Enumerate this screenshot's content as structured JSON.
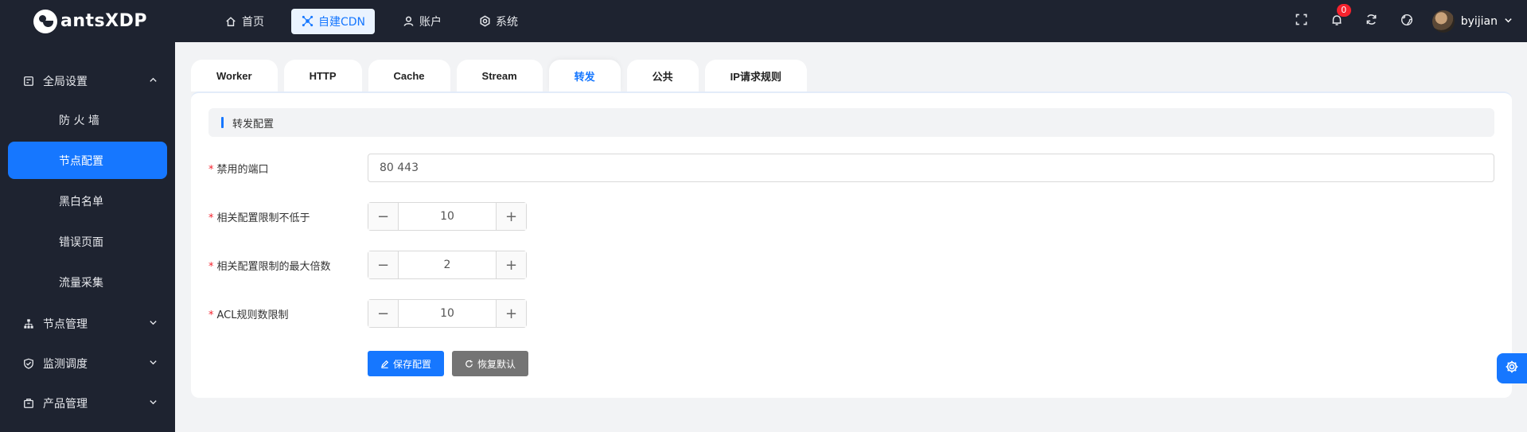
{
  "brand": {
    "name": "antsXDP"
  },
  "topnav": [
    {
      "label": "首页",
      "icon": "home-icon"
    },
    {
      "label": "自建CDN",
      "icon": "cdn-icon",
      "active": true
    },
    {
      "label": "账户",
      "icon": "user-icon"
    },
    {
      "label": "系统",
      "icon": "settings-icon"
    }
  ],
  "header": {
    "notification_count": "0",
    "username": "byijian"
  },
  "sidebar": {
    "group_global": "全局设置",
    "items": [
      {
        "label": "防 火 墙"
      },
      {
        "label": "节点配置",
        "active": true
      },
      {
        "label": "黑白名单"
      },
      {
        "label": "错误页面"
      },
      {
        "label": "流量采集"
      }
    ],
    "group_nodes": "节点管理",
    "group_monitor": "监测调度",
    "group_product": "产品管理"
  },
  "tabs": [
    {
      "label": "Worker"
    },
    {
      "label": "HTTP"
    },
    {
      "label": "Cache"
    },
    {
      "label": "Stream"
    },
    {
      "label": "转发",
      "active": true
    },
    {
      "label": "公共"
    },
    {
      "label": "IP请求规则"
    }
  ],
  "section": {
    "title": "转发配置"
  },
  "form": {
    "required_mark": "*",
    "banned_ports": {
      "label": "禁用的端口",
      "value": "80 443"
    },
    "min_limit": {
      "label": "相关配置限制不低于",
      "value": "10"
    },
    "max_multiple": {
      "label": "相关配置限制的最大倍数",
      "value": "2"
    },
    "acl_limit": {
      "label": "ACL规则数限制",
      "value": "10"
    }
  },
  "actions": {
    "save": "保存配置",
    "reset": "恢复默认"
  },
  "colors": {
    "primary": "#1677ff",
    "sidebar_bg": "#1e2330",
    "badge": "#f5222d"
  }
}
